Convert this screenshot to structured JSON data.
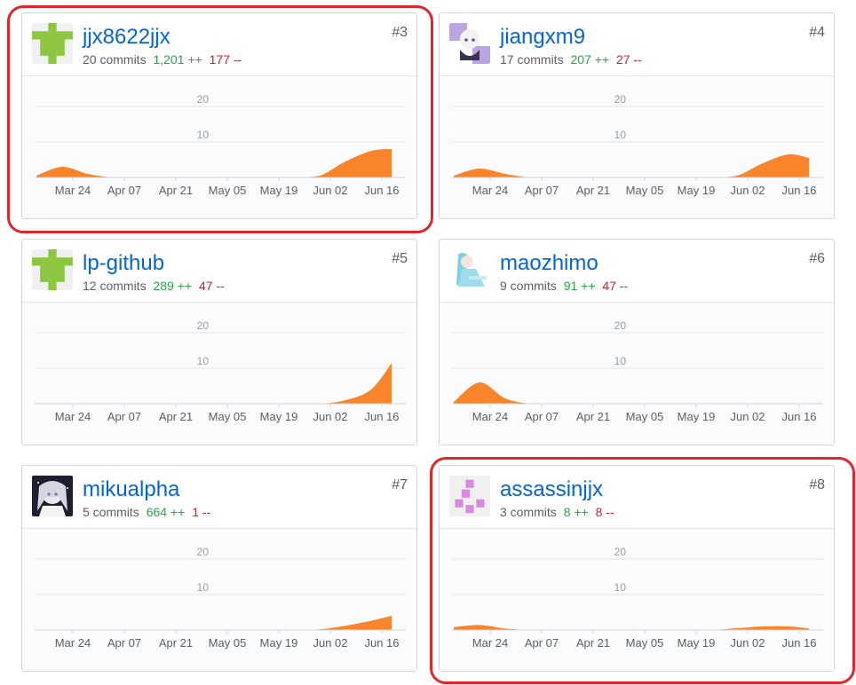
{
  "colors": {
    "area": "#f9842a",
    "link": "#0366d6",
    "additions": "#28a745",
    "deletions": "#cb2431",
    "highlight": "#e0262b"
  },
  "y_ticks": [
    "20",
    "10"
  ],
  "x_ticks": [
    "Mar 24",
    "Apr 07",
    "Apr 21",
    "May 05",
    "May 19",
    "Jun 02",
    "Jun 16"
  ],
  "contributors": [
    {
      "rank": "#3",
      "username": "jjx8622jjx",
      "commits": "20 commits",
      "additions": "1,201 ++",
      "deletions": "177 --",
      "avatar": "identicon-green-icon",
      "highlighted": true,
      "chart_data": {
        "type": "area",
        "x": [
          "Mar 17",
          "Mar 24",
          "Mar 31",
          "Apr 07",
          "Apr 14",
          "Apr 21",
          "Apr 28",
          "May 05",
          "May 12",
          "May 19",
          "May 26",
          "Jun 02",
          "Jun 09",
          "Jun 16",
          "Jun 23"
        ],
        "values": [
          0.5,
          3,
          1,
          0,
          0,
          0,
          0,
          0,
          0,
          0,
          0,
          0.5,
          4.5,
          7.5,
          8
        ],
        "ylim": [
          0,
          20
        ]
      }
    },
    {
      "rank": "#4",
      "username": "jiangxm9",
      "commits": "17 commits",
      "additions": "207 ++",
      "deletions": "27 --",
      "avatar": "anime-avatar-purple-icon",
      "highlighted": false,
      "chart_data": {
        "type": "area",
        "x": [
          "Mar 17",
          "Mar 24",
          "Mar 31",
          "Apr 07",
          "Apr 14",
          "Apr 21",
          "Apr 28",
          "May 05",
          "May 12",
          "May 19",
          "May 26",
          "Jun 02",
          "Jun 09",
          "Jun 16",
          "Jun 23"
        ],
        "values": [
          0.5,
          2.5,
          1,
          0,
          0,
          0,
          0,
          0,
          0,
          0,
          0,
          0.5,
          4,
          6.5,
          5.5
        ],
        "ylim": [
          0,
          20
        ]
      }
    },
    {
      "rank": "#5",
      "username": "lp-github",
      "commits": "12 commits",
      "additions": "289 ++",
      "deletions": "47 --",
      "avatar": "identicon-green-icon",
      "highlighted": false,
      "chart_data": {
        "type": "area",
        "x": [
          "Mar 17",
          "Mar 24",
          "Mar 31",
          "Apr 07",
          "Apr 14",
          "Apr 21",
          "Apr 28",
          "May 05",
          "May 12",
          "May 19",
          "May 26",
          "Jun 02",
          "Jun 09",
          "Jun 16",
          "Jun 23"
        ],
        "values": [
          0,
          0,
          0,
          0,
          0,
          0,
          0,
          0,
          0,
          0,
          0,
          0,
          1,
          4,
          11.5
        ],
        "ylim": [
          0,
          20
        ]
      }
    },
    {
      "rank": "#6",
      "username": "maozhimo",
      "commits": "9 commits",
      "additions": "91 ++",
      "deletions": "47 --",
      "avatar": "anime-avatar-teal-icon",
      "highlighted": false,
      "chart_data": {
        "type": "area",
        "x": [
          "Mar 17",
          "Mar 24",
          "Mar 31",
          "Apr 07",
          "Apr 14",
          "Apr 21",
          "Apr 28",
          "May 05",
          "May 12",
          "May 19",
          "May 26",
          "Jun 02",
          "Jun 09",
          "Jun 16",
          "Jun 23"
        ],
        "values": [
          0.5,
          6,
          1.5,
          0,
          0,
          0,
          0,
          0,
          0,
          0,
          0,
          0,
          0,
          0,
          0
        ],
        "ylim": [
          0,
          20
        ]
      }
    },
    {
      "rank": "#7",
      "username": "mikualpha",
      "commits": "5 commits",
      "additions": "664 ++",
      "deletions": "1 --",
      "avatar": "anime-avatar-dark-icon",
      "highlighted": false,
      "chart_data": {
        "type": "area",
        "x": [
          "Mar 17",
          "Mar 24",
          "Mar 31",
          "Apr 07",
          "Apr 14",
          "Apr 21",
          "Apr 28",
          "May 05",
          "May 12",
          "May 19",
          "May 26",
          "Jun 02",
          "Jun 09",
          "Jun 16",
          "Jun 23"
        ],
        "values": [
          0,
          0,
          0,
          0,
          0,
          0,
          0,
          0,
          0,
          0,
          0,
          0.2,
          1.2,
          2.6,
          4
        ],
        "ylim": [
          0,
          20
        ]
      }
    },
    {
      "rank": "#8",
      "username": "assassinjjx",
      "commits": "3 commits",
      "additions": "8 ++",
      "deletions": "8 --",
      "avatar": "identicon-pink-icon",
      "highlighted": true,
      "chart_data": {
        "type": "area",
        "x": [
          "Mar 17",
          "Mar 24",
          "Mar 31",
          "Apr 07",
          "Apr 14",
          "Apr 21",
          "Apr 28",
          "May 05",
          "May 12",
          "May 19",
          "May 26",
          "Jun 02",
          "Jun 09",
          "Jun 16",
          "Jun 23"
        ],
        "values": [
          0.8,
          1.4,
          0.4,
          0,
          0,
          0,
          0,
          0,
          0,
          0,
          0,
          0.5,
          1,
          1,
          0.4
        ],
        "ylim": [
          0,
          20
        ]
      }
    }
  ]
}
